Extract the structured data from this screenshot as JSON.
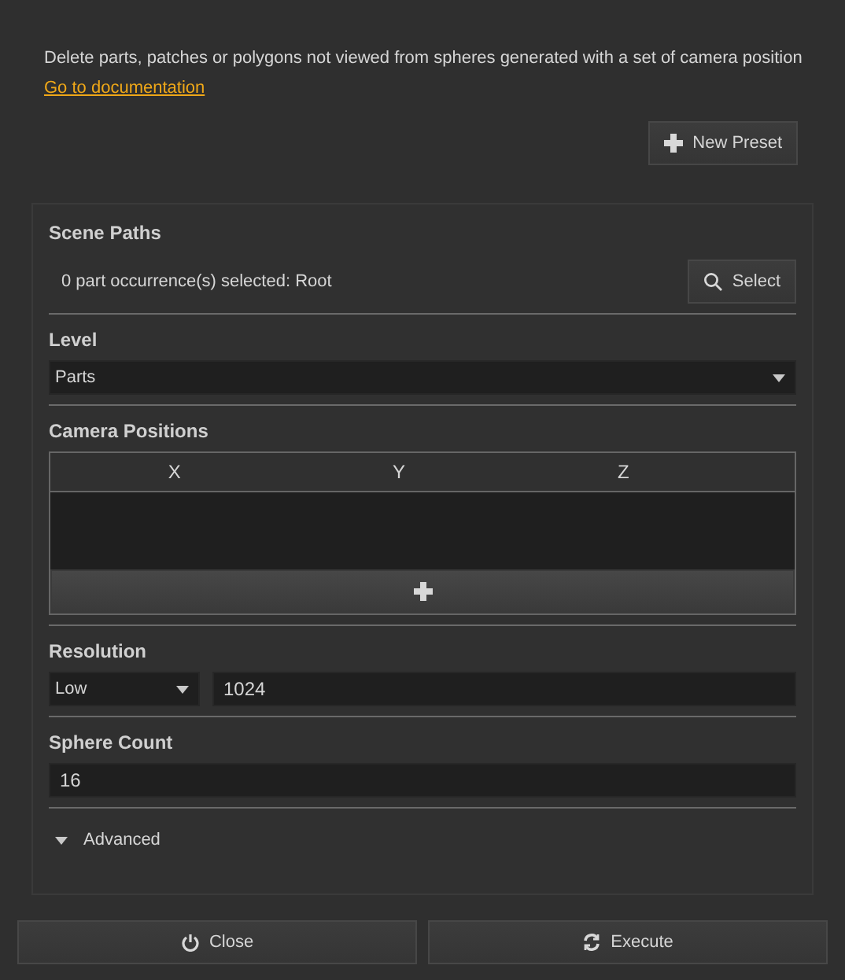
{
  "description": "Delete parts, patches or polygons not viewed from spheres generated with a set of camera position",
  "doc_link": "Go to documentation",
  "new_preset_button": "New Preset",
  "scene_paths": {
    "title": "Scene Paths",
    "status": "0 part occurrence(s) selected: Root",
    "select_button": "Select"
  },
  "level": {
    "title": "Level",
    "value": "Parts"
  },
  "camera_positions": {
    "title": "Camera Positions",
    "columns": [
      "X",
      "Y",
      "Z"
    ]
  },
  "resolution": {
    "title": "Resolution",
    "preset": "Low",
    "value": "1024"
  },
  "sphere_count": {
    "title": "Sphere Count",
    "value": "16"
  },
  "advanced": {
    "label": "Advanced"
  },
  "buttons": [
    {
      "kind": "close",
      "label": "Close"
    },
    {
      "kind": "execute",
      "label": "Execute"
    }
  ]
}
